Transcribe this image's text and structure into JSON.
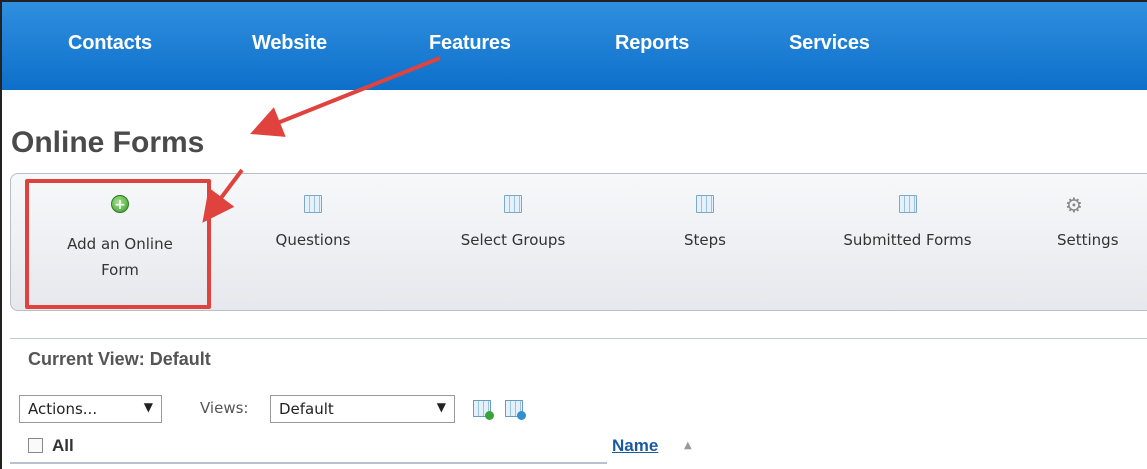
{
  "nav": {
    "items": [
      {
        "label": "Contacts"
      },
      {
        "label": "Website"
      },
      {
        "label": "Features"
      },
      {
        "label": "Reports"
      },
      {
        "label": "Services"
      }
    ]
  },
  "page_title": "Online Forms",
  "toolbar": {
    "items": [
      {
        "label": "Add an Online Form",
        "icon": "plus-circle-icon"
      },
      {
        "label": "Questions",
        "icon": "table-icon"
      },
      {
        "label": "Select Groups",
        "icon": "table-icon"
      },
      {
        "label": "Steps",
        "icon": "table-icon"
      },
      {
        "label": "Submitted Forms",
        "icon": "table-icon"
      },
      {
        "label": "Settings",
        "icon": "gear-icon"
      }
    ]
  },
  "view": {
    "current_label": "Current View: Default",
    "actions_label": "Actions...",
    "views_label": "Views:",
    "views_value": "Default"
  },
  "table": {
    "select_all_label": "All",
    "columns": [
      {
        "label": "Name"
      }
    ]
  },
  "colors": {
    "nav_top": "#2f8fe0",
    "nav_bottom": "#0d6fc9",
    "highlight": "#e0433d",
    "link": "#1a5aa0"
  }
}
